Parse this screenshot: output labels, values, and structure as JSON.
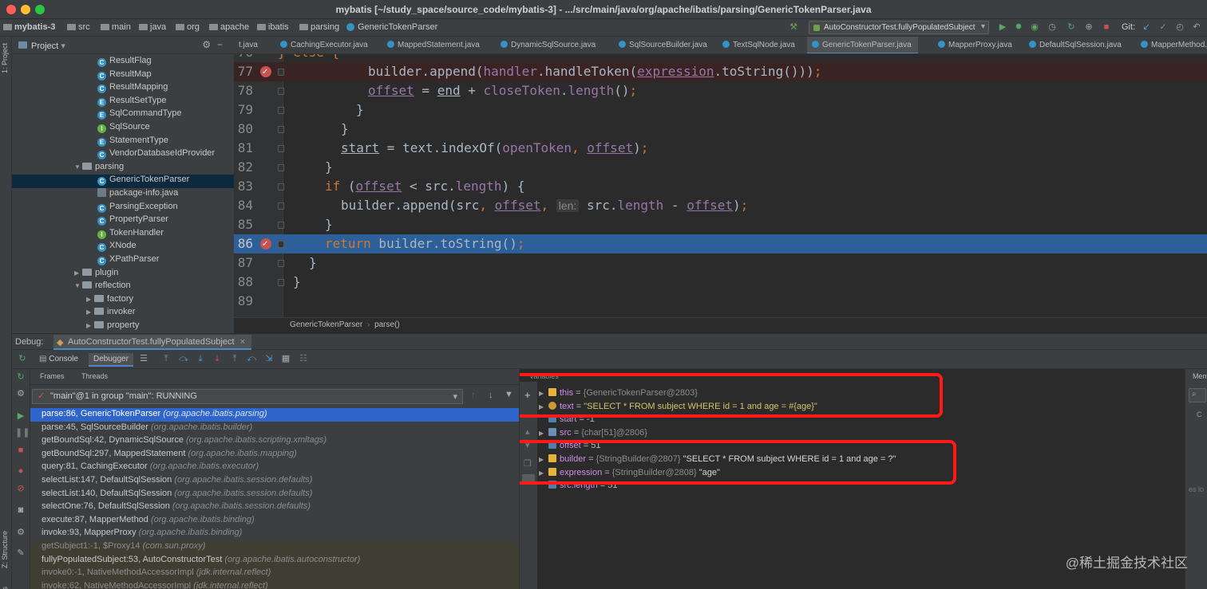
{
  "window": {
    "title": "mybatis [~/study_space/source_code/mybatis-3] - .../src/main/java/org/apache/ibatis/parsing/GenericTokenParser.java"
  },
  "navbar": {
    "crumbs": [
      "mybatis-3",
      "src",
      "main",
      "java",
      "org",
      "apache",
      "ibatis",
      "parsing",
      "GenericTokenParser"
    ],
    "run_config": "AutoConstructorTest.fullyPopulatedSubject",
    "git_label": "Git:"
  },
  "left_strip": {
    "project_tab": "1: Project",
    "structure_tab": "Z: Structure",
    "favorites_tab": "avorites"
  },
  "project_panel": {
    "header": "Project",
    "items": [
      {
        "label": "ResultFlag",
        "icon": "class-icon",
        "depth": 3
      },
      {
        "label": "ResultMap",
        "icon": "class-icon",
        "depth": 3
      },
      {
        "label": "ResultMapping",
        "icon": "class-icon",
        "depth": 3
      },
      {
        "label": "ResultSetType",
        "icon": "enum-icon",
        "depth": 3
      },
      {
        "label": "SqlCommandType",
        "icon": "enum-icon",
        "depth": 3
      },
      {
        "label": "SqlSource",
        "icon": "interface-icon",
        "depth": 3
      },
      {
        "label": "StatementType",
        "icon": "enum-icon",
        "depth": 3
      },
      {
        "label": "VendorDatabaseIdProvider",
        "icon": "class-icon",
        "depth": 3
      },
      {
        "label": "parsing",
        "icon": "folder-icon",
        "depth": 2,
        "expanded": true
      },
      {
        "label": "GenericTokenParser",
        "icon": "class-icon",
        "depth": 3,
        "selected": true
      },
      {
        "label": "package-info.java",
        "icon": "file-icon",
        "depth": 3
      },
      {
        "label": "ParsingException",
        "icon": "class-icon",
        "depth": 3
      },
      {
        "label": "PropertyParser",
        "icon": "class-icon",
        "depth": 3
      },
      {
        "label": "TokenHandler",
        "icon": "interface-icon",
        "depth": 3
      },
      {
        "label": "XNode",
        "icon": "class-icon",
        "depth": 3
      },
      {
        "label": "XPathParser",
        "icon": "class-icon",
        "depth": 3
      },
      {
        "label": "plugin",
        "icon": "folder-icon",
        "depth": 2,
        "expanded": false
      },
      {
        "label": "reflection",
        "icon": "folder-icon",
        "depth": 2,
        "expanded": true
      },
      {
        "label": "factory",
        "icon": "folder-icon",
        "depth": 3,
        "expanded": false
      },
      {
        "label": "invoker",
        "icon": "folder-icon",
        "depth": 3,
        "expanded": false
      },
      {
        "label": "property",
        "icon": "folder-icon",
        "depth": 3,
        "expanded": false
      }
    ]
  },
  "editor": {
    "tabs": [
      {
        "label": "t.java",
        "icon": "class-icon"
      },
      {
        "label": "CachingExecutor.java",
        "icon": "class-icon"
      },
      {
        "label": "MappedStatement.java",
        "icon": "class-icon"
      },
      {
        "label": "DynamicSqlSource.java",
        "icon": "class-icon"
      },
      {
        "label": "SqlSourceBuilder.java",
        "icon": "class-icon"
      },
      {
        "label": "TextSqlNode.java",
        "icon": "class-icon"
      },
      {
        "label": "GenericTokenParser.java",
        "icon": "class-icon",
        "active": true
      },
      {
        "label": "MapperProxy.java",
        "icon": "class-icon"
      },
      {
        "label": "DefaultSqlSession.java",
        "icon": "class-icon"
      },
      {
        "label": "MapperMethod.j",
        "icon": "class-icon"
      }
    ],
    "lines": [
      {
        "num": "76",
        "text": "      } else {"
      },
      {
        "num": "77",
        "text": "builder.append(handler.handleToken(expression.toString()));",
        "breakpoint": true
      },
      {
        "num": "78",
        "text": "offset = end + closeToken.length();"
      },
      {
        "num": "79",
        "text": "}"
      },
      {
        "num": "80",
        "text": "}"
      },
      {
        "num": "81",
        "text": "start = text.indexOf(openToken, offset);"
      },
      {
        "num": "82",
        "text": "}"
      },
      {
        "num": "83",
        "text": "if (offset < src.length) {"
      },
      {
        "num": "84",
        "text": "builder.append(src, offset, len: src.length - offset);"
      },
      {
        "num": "85",
        "text": "}"
      },
      {
        "num": "86",
        "text": "return builder.toString();",
        "breakpoint": true,
        "current": true
      },
      {
        "num": "87",
        "text": "}"
      },
      {
        "num": "88",
        "text": "}"
      },
      {
        "num": "89",
        "text": ""
      }
    ],
    "param_hint": "len:",
    "breadcrumb": [
      "GenericTokenParser",
      "parse()"
    ]
  },
  "debug": {
    "label": "Debug:",
    "session": "AutoConstructorTest.fullyPopulatedSubject",
    "tabs": {
      "console": "Console",
      "debugger": "Debugger"
    },
    "frames_tab": "Frames",
    "threads_tab": "Threads",
    "thread_selector": "\"main\"@1 in group \"main\": RUNNING",
    "frames": [
      {
        "method": "parse:86, GenericTokenParser",
        "pkg": "(org.apache.ibatis.parsing)",
        "selected": true
      },
      {
        "method": "parse:45, SqlSourceBuilder",
        "pkg": "(org.apache.ibatis.builder)"
      },
      {
        "method": "getBoundSql:42, DynamicSqlSource",
        "pkg": "(org.apache.ibatis.scripting.xmltags)"
      },
      {
        "method": "getBoundSql:297, MappedStatement",
        "pkg": "(org.apache.ibatis.mapping)"
      },
      {
        "method": "query:81, CachingExecutor",
        "pkg": "(org.apache.ibatis.executor)"
      },
      {
        "method": "selectList:147, DefaultSqlSession",
        "pkg": "(org.apache.ibatis.session.defaults)"
      },
      {
        "method": "selectList:140, DefaultSqlSession",
        "pkg": "(org.apache.ibatis.session.defaults)"
      },
      {
        "method": "selectOne:76, DefaultSqlSession",
        "pkg": "(org.apache.ibatis.session.defaults)"
      },
      {
        "method": "execute:87, MapperMethod",
        "pkg": "(org.apache.ibatis.binding)"
      },
      {
        "method": "invoke:93, MapperProxy",
        "pkg": "(org.apache.ibatis.binding)"
      },
      {
        "method": "getSubject1:-1, $Proxy14",
        "pkg": "(com.sun.proxy)",
        "library": true
      },
      {
        "method": "fullyPopulatedSubject:53, AutoConstructorTest",
        "pkg": "(org.apache.ibatis.autoconstructor)",
        "library": true
      },
      {
        "method": "invoke0:-1, NativeMethodAccessorImpl",
        "pkg": "(jdk.internal.reflect)",
        "library": true
      },
      {
        "method": "invoke:62, NativeMethodAccessorImpl",
        "pkg": "(jdk.internal.reflect)",
        "library": true
      }
    ],
    "variables_title": "Variables",
    "variables": [
      {
        "name": "this",
        "value": "{GenericTokenParser@2803}",
        "icon": "field-icon",
        "expandable": true
      },
      {
        "name": "text",
        "value": "\"SELECT * FROM subject WHERE id = 1 and age = #{age}\"",
        "icon": "param-icon",
        "expandable": true
      },
      {
        "name": "start",
        "value": "-1",
        "icon": "local-icon",
        "expandable": false
      },
      {
        "name": "src",
        "value": "{char[51]@2806}",
        "icon": "array-icon",
        "expandable": true
      },
      {
        "name": "offset",
        "value": "51",
        "icon": "local-icon",
        "expandable": false
      },
      {
        "name": "builder",
        "value": "{StringBuilder@2807} \"SELECT * FROM subject WHERE id = 1 and age = ?\"",
        "icon": "field-icon",
        "expandable": true
      },
      {
        "name": "expression",
        "value": "{StringBuilder@2808} \"age\"",
        "icon": "field-icon",
        "expandable": true
      },
      {
        "name": "src.length",
        "value": "51",
        "icon": "watch-icon",
        "expandable": false
      }
    ],
    "memory_tab": "Mem",
    "memory_hint": "es lo"
  },
  "watermark": "@稀土掘金技术社区",
  "colors": {
    "highlight_box": "#ff1a1a",
    "current_line": "#2d6099",
    "selected_frame": "#2f65ca"
  }
}
